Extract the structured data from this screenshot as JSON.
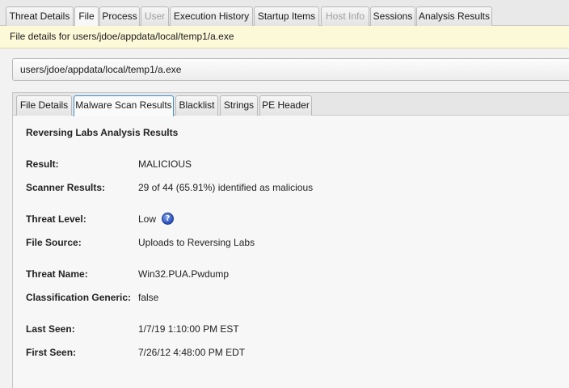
{
  "top_tabs": [
    {
      "label": "Threat Details",
      "state": "normal"
    },
    {
      "label": "File",
      "state": "active"
    },
    {
      "label": "Process",
      "state": "normal"
    },
    {
      "label": "User",
      "state": "disabled"
    },
    {
      "label": "Execution History",
      "state": "normal"
    },
    {
      "label": "Startup Items",
      "state": "normal"
    },
    {
      "label": "Host Info",
      "state": "disabled"
    },
    {
      "label": "Sessions",
      "state": "normal"
    },
    {
      "label": "Analysis Results",
      "state": "normal"
    }
  ],
  "info_bar": {
    "text": "File details for users/jdoe/appdata/local/temp1/a.exe"
  },
  "path_field": {
    "value": "users/jdoe/appdata/local/temp1/a.exe"
  },
  "inner_tabs": [
    {
      "label": "File Details",
      "state": "normal"
    },
    {
      "label": "Malware Scan Results",
      "state": "active"
    },
    {
      "label": "Blacklist",
      "state": "normal"
    },
    {
      "label": "Strings",
      "state": "normal"
    },
    {
      "label": "PE Header",
      "state": "normal"
    }
  ],
  "results": {
    "section_title": "Reversing Labs Analysis Results",
    "rows": [
      {
        "label": "Result:",
        "value": "MALICIOUS"
      },
      {
        "label": "Scanner Results:",
        "value": "29 of 44 (65.91%) identified as malicious"
      },
      {
        "label": "Threat Level:",
        "value": "Low"
      },
      {
        "label": "File Source:",
        "value": "Uploads to Reversing Labs"
      },
      {
        "label": "Threat Name:",
        "value": "Win32.PUA.Pwdump"
      },
      {
        "label": "Classification Generic:",
        "value": "false"
      },
      {
        "label": "Last Seen:",
        "value": "1/7/19 1:10:00 PM EST"
      },
      {
        "label": "First Seen:",
        "value": "7/26/12 4:48:00 PM EDT"
      }
    ],
    "help_icon": {
      "name": "help-icon",
      "glyph": "?"
    }
  }
}
